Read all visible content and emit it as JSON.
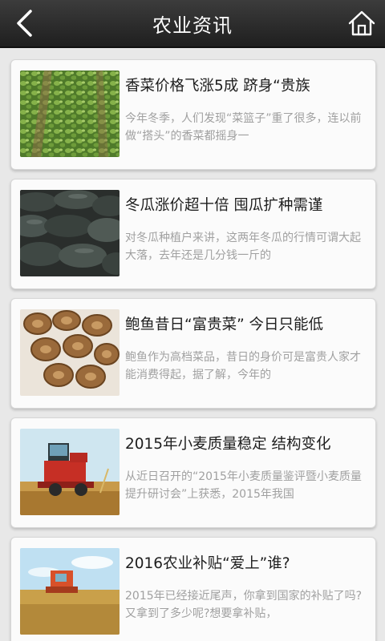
{
  "header": {
    "title": "农业资讯",
    "back_icon": "chevron-left-icon",
    "home_icon": "home-icon"
  },
  "articles": [
    {
      "title": "香菜价格飞涨5成 跻身“贵族",
      "summary": "今年冬季，人们发现“菜篮子”重了很多，连以前做“搭头”的香菜都摇身一",
      "image": "coriander-field-image"
    },
    {
      "title": "冬瓜涨价超十倍 囤瓜扩种需谨",
      "summary": "对冬瓜种植户来讲，这两年冬瓜的行情可谓大起大落，去年还是几分钱一斤的",
      "image": "winter-melon-pile-image"
    },
    {
      "title": "鲍鱼昔日“富贵菜” 今日只能低",
      "summary": "鲍鱼作为高档菜品，昔日的身价可是富贵人家才能消费得起，据了解，今年的",
      "image": "dried-abalone-image"
    },
    {
      "title": "2015年小麦质量稳定 结构变化",
      "summary": "从近日召开的“2015年小麦质量鉴评暨小麦质量提升研讨会”上获悉，2015年我国",
      "image": "combine-harvester-image"
    },
    {
      "title": "2016农业补贴“爱上”谁?",
      "summary": "2015年已经接近尾声，你拿到国家的补贴了吗?又拿到了多少呢?想要拿补贴，",
      "image": "wheat-harvest-field-image"
    }
  ]
}
